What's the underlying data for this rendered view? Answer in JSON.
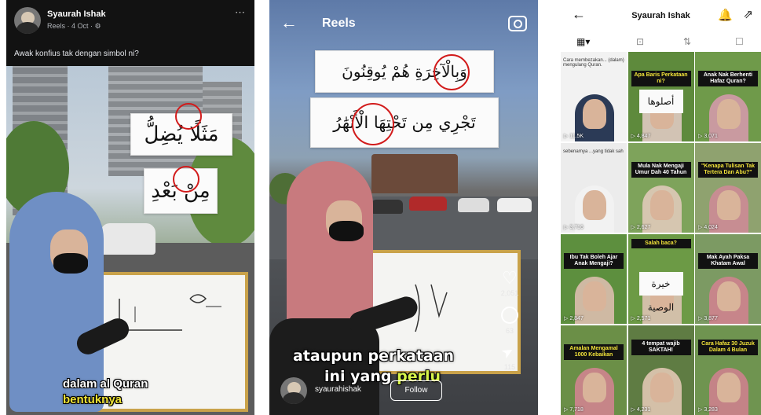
{
  "facebook_post": {
    "author": "Syaurah Ishak",
    "meta": "Reels · 4 Oct · ⚙",
    "more_icon": "⋯",
    "caption": "Awak konfius tak dengan simbol ni?",
    "arabic_line1": "مَثَلًا يُضِلُّ",
    "arabic_line2": "مِنْ بَعْدِ",
    "subtitle_line1": "dalam al Quran",
    "subtitle_line2": "bentuknya"
  },
  "reels": {
    "title": "Reels",
    "back_icon": "←",
    "arabic_line1": "وَبِالْآخِرَةِ هُمْ يُوقِنُونَ",
    "arabic_line2": "تَجْرِي مِن تَحْتِهَا الْأَنْهَٰرُ",
    "like_count": "2,051",
    "comment_count": "63",
    "share_count": "115",
    "subtitle_line1": "ataupun perkataan",
    "subtitle_line2_a": "ini yang ",
    "subtitle_line2_b": "perlu",
    "username": "syaurahishak",
    "follow_label": "Follow"
  },
  "profile": {
    "back_icon": "←",
    "name": "Syaurah Ishak",
    "bell_icon": "🔔",
    "share_icon": "⇗",
    "tabs": [
      "▦▾",
      "⊡",
      "⇅",
      "☐"
    ],
    "cells": [
      {
        "label": "",
        "text": "Cara membezakan... (dalam) mengulang Quran.",
        "views": "▷ 11.5K",
        "bg": "#f2f2f2",
        "hijab": "#2b3a56"
      },
      {
        "label": "Apa Baris Perkataan ni?",
        "text": "",
        "views": "▷ 4,847",
        "bg": "#5e8a3c",
        "hijab": "#d2c3b4",
        "arabic": "أصلوها"
      },
      {
        "label": "Anak Nak Berhenti Hafaz Quran?",
        "text": "",
        "views": "▷ 3,071",
        "bg": "#6f9a4a",
        "hijab": "#c99aa0"
      },
      {
        "label": "",
        "text": "sebenarnya ...yang tidak sah",
        "views": "▷ 3,716",
        "bg": "#ececec",
        "hijab": "#f2f2f2"
      },
      {
        "label": "Mula Nak Mengaji Umur Dah 40 Tahun",
        "text": "",
        "views": "▷ 2,627",
        "bg": "#7ea35b",
        "hijab": "#d6c6b0"
      },
      {
        "label": "\"Kenapa Tulisan Tak Tertera Dan Abu?\"",
        "text": "",
        "views": "▷ 4,024",
        "bg": "#8fa26f",
        "hijab": "#c78d92"
      },
      {
        "label": "Ibu Tak Boleh Ajar Anak Mengaji?",
        "text": "",
        "views": "▷ 2,847",
        "bg": "#5d8f3e",
        "hijab": "#cfb9a3"
      },
      {
        "label": "Salah baca?",
        "text": "",
        "views": "▷ 2,571",
        "bg": "#6c9a45",
        "hijab": "#d1bfa8",
        "arabic": "خيرة الوصية"
      },
      {
        "label": "Mak Ayah Paksa Khatam Awal",
        "text": "",
        "views": "▷ 3,877",
        "bg": "#7c9a63",
        "hijab": "#c7858a"
      },
      {
        "label": "Amalan Mengamal 1000 Kebaikan",
        "text": "",
        "views": "▷ 7,718",
        "bg": "#6b8f47",
        "hijab": "#c68588"
      },
      {
        "label": "4 tempat wajib SAKTAH!",
        "text": "",
        "views": "▷ 4,231",
        "bg": "#5f7c43",
        "hijab": "#d4c0a8"
      },
      {
        "label": "Cara Hafaz 30 Juzuk Dalam 4 Bulan",
        "text": "",
        "views": "▷ 3,283",
        "bg": "#6f9450",
        "hijab": "#c48387"
      }
    ]
  }
}
